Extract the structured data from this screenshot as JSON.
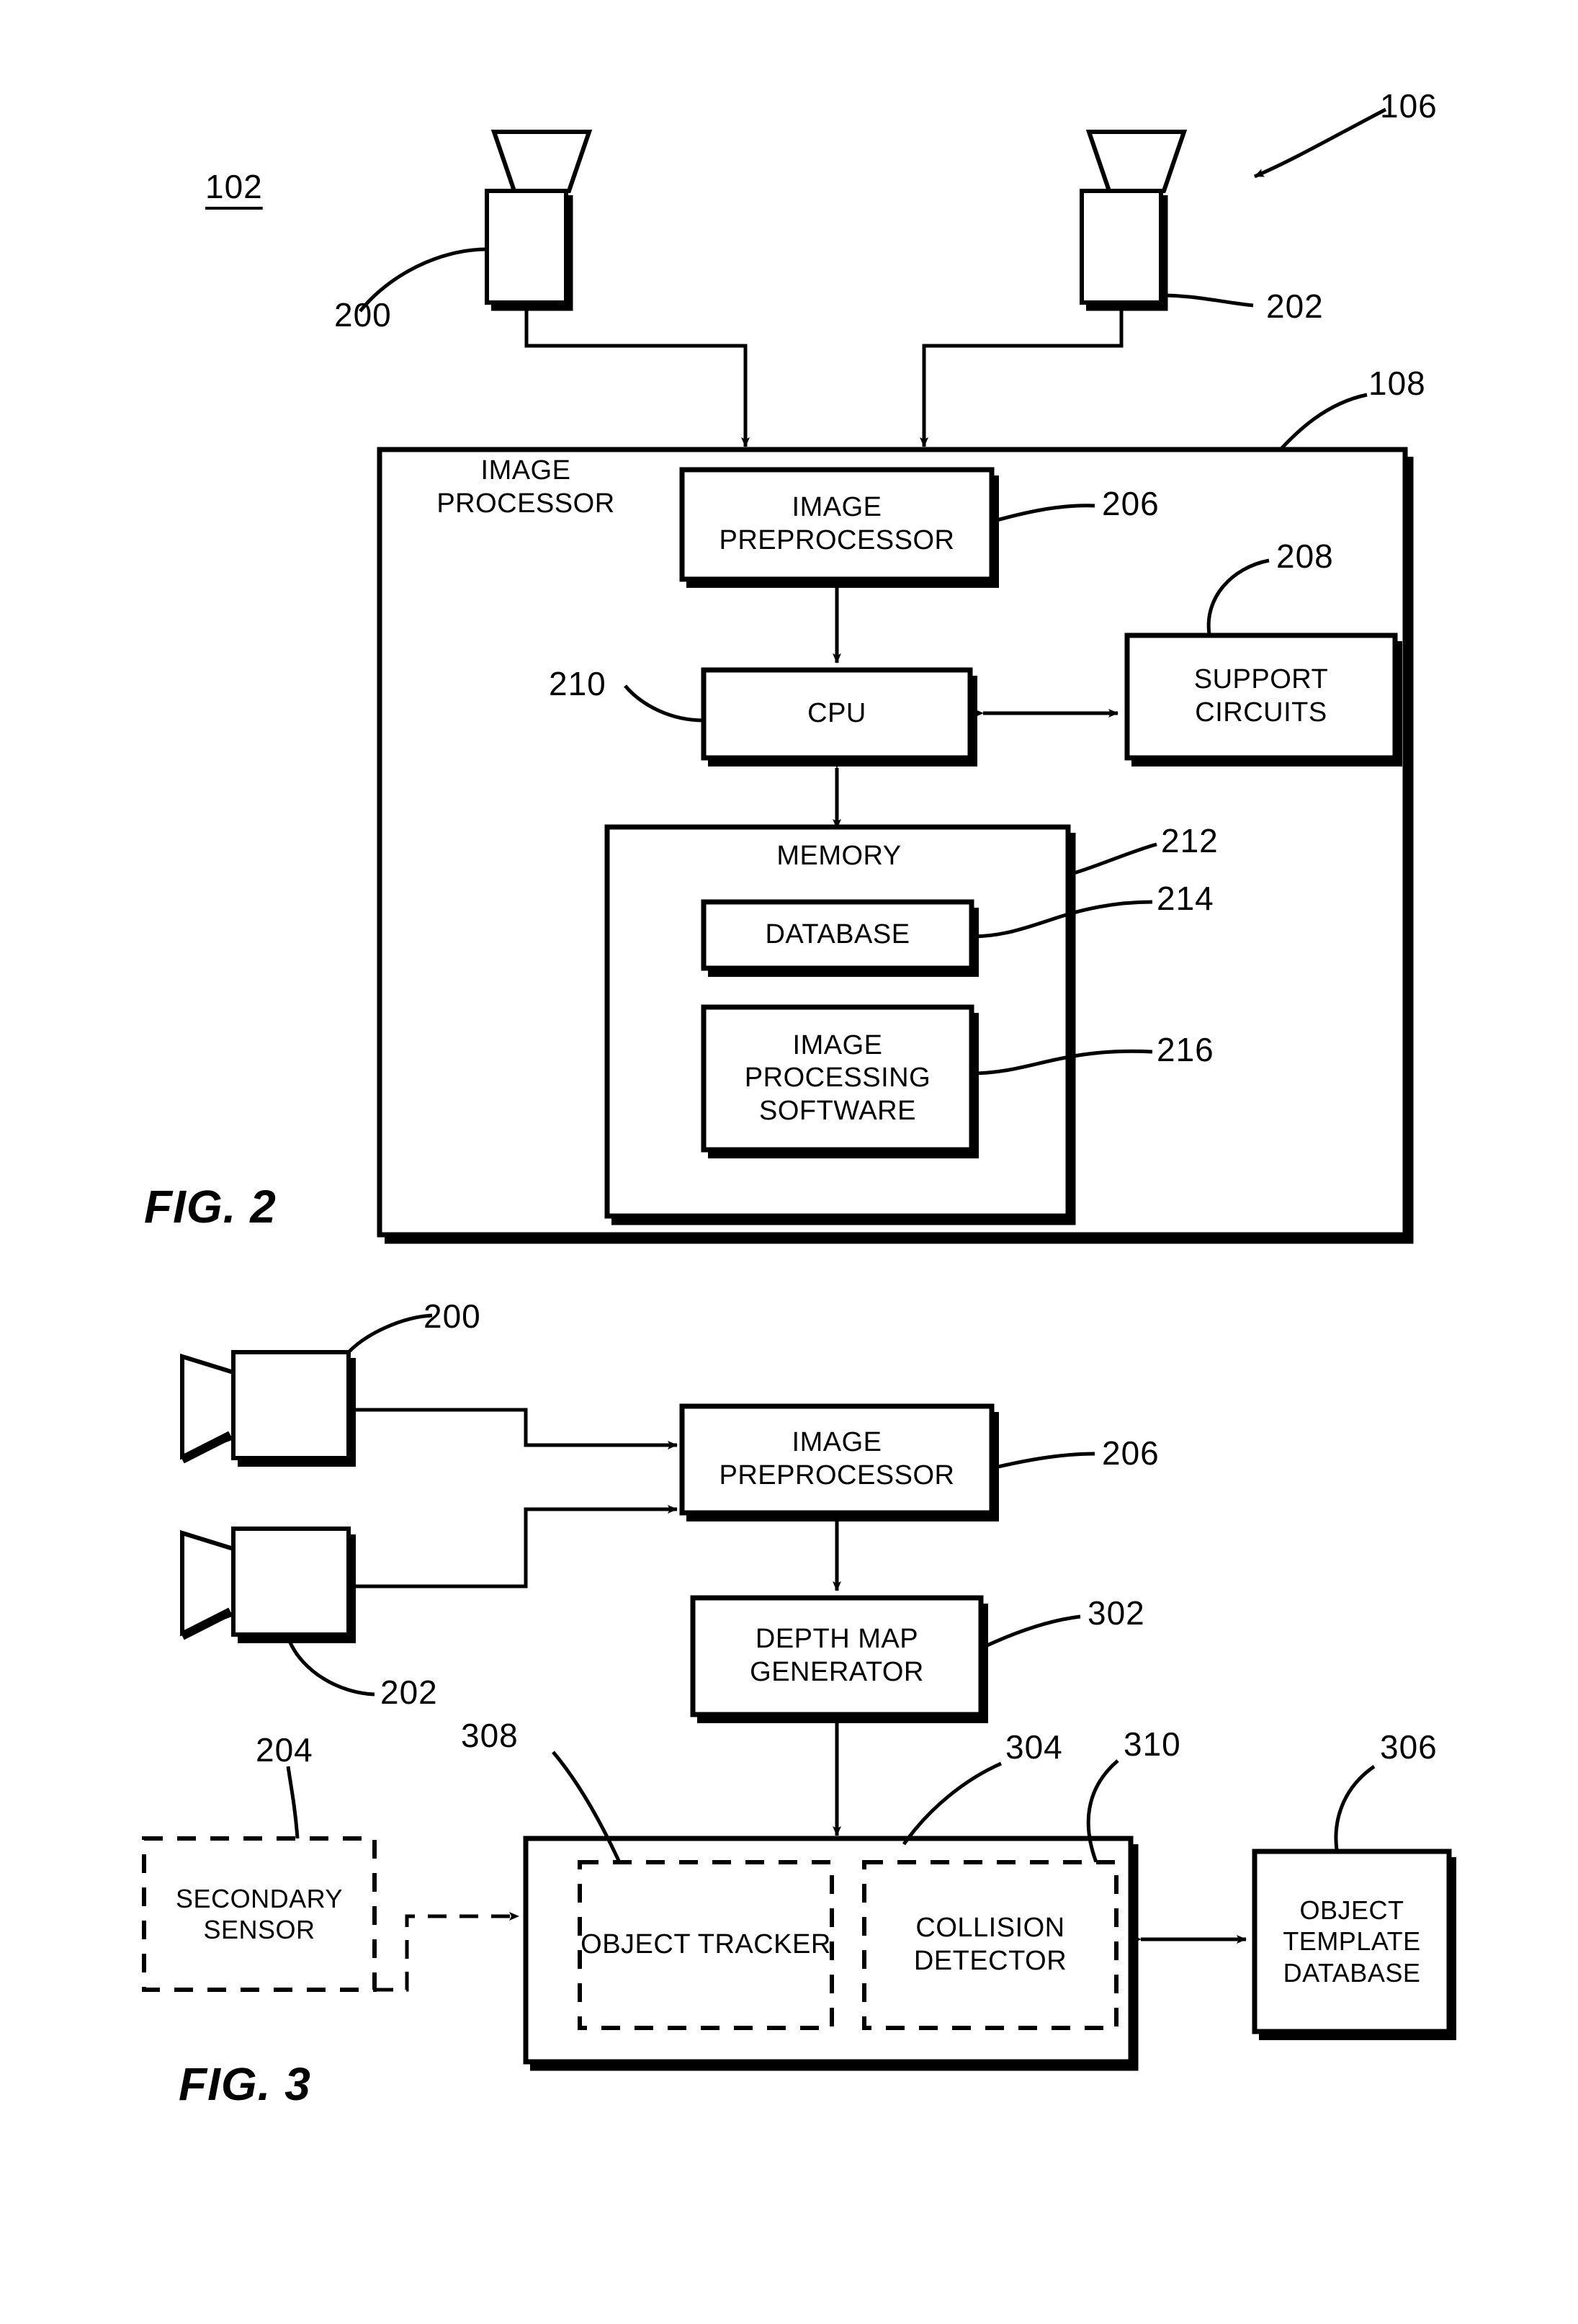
{
  "figures": [
    {
      "id": "fig2",
      "caption": "FIG. 2",
      "system_ref": "102",
      "refs": {
        "camera_left": "200",
        "camera_right": "202",
        "system_arrow": "106",
        "outer_box": "108",
        "preprocessor": "206",
        "support_circuits": "208",
        "cpu": "210",
        "memory": "212",
        "database": "214",
        "software": "216"
      },
      "blocks": {
        "image_processor_label": "IMAGE\nPROCESSOR",
        "image_preprocessor": "IMAGE\nPREPROCESSOR",
        "cpu": "CPU",
        "support_circuits": "SUPPORT\nCIRCUITS",
        "memory": "MEMORY",
        "database": "DATABASE",
        "image_processing_software": "IMAGE\nPROCESSING\nSOFTWARE"
      }
    },
    {
      "id": "fig3",
      "caption": "FIG. 3",
      "refs": {
        "camera_top": "200",
        "camera_bottom": "202",
        "preprocessor": "206",
        "depth_map_generator": "302",
        "secondary_sensor": "204",
        "object_tracker": "308",
        "container": "304",
        "collision_detector": "310",
        "object_template_database": "306"
      },
      "blocks": {
        "image_preprocessor": "IMAGE\nPREPROCESSOR",
        "depth_map_generator": "DEPTH MAP\nGENERATOR",
        "secondary_sensor": "SECONDARY\nSENSOR",
        "object_tracker": "OBJECT\nTRACKER",
        "collision_detector": "COLLISION\nDETECTOR",
        "object_template_database": "OBJECT\nTEMPLATE\nDATABASE"
      }
    }
  ],
  "colors": {
    "ink": "#000000",
    "paper": "#ffffff"
  }
}
